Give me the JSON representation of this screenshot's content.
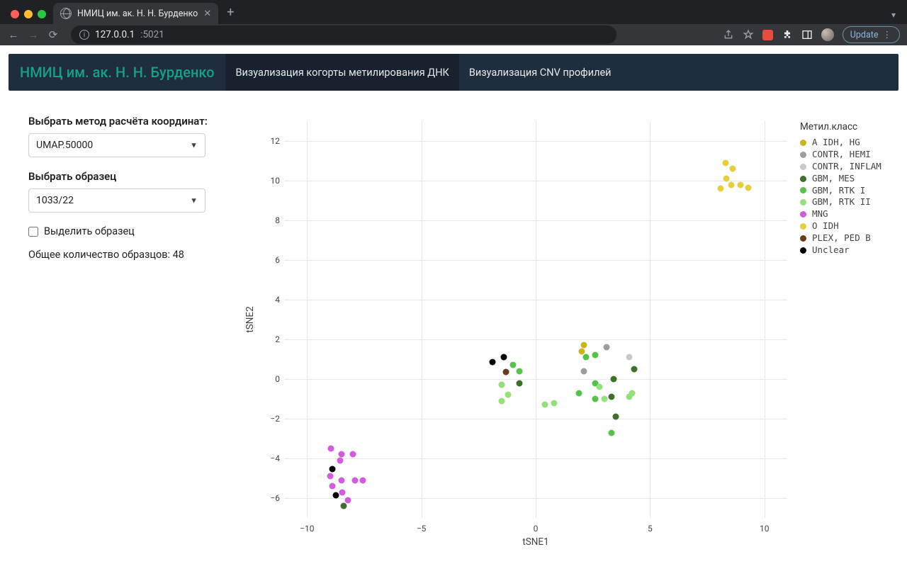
{
  "chrome": {
    "tab_title": "НМИЦ им. ак. Н. Н. Бурденко",
    "url_host": "127.0.0.1",
    "url_port": ":5021",
    "update_label": "Update"
  },
  "nav": {
    "brand": "НМИЦ им. ак. Н. Н. Бурденко",
    "item1": "Визуализация когорты метилирования ДНК",
    "item2": "Визуализация CNV профилей"
  },
  "sidebar": {
    "method_label": "Выбрать метод расчёта координат:",
    "method_value": "UMAP.50000",
    "sample_label": "Выбрать образец",
    "sample_value": "1033/22",
    "highlight_label": "Выделить образец",
    "count_text": "Общее количество образцов: 48"
  },
  "legend": {
    "title": "Метил.класс",
    "items": [
      {
        "label": "A IDH, HG",
        "color": "#c9b61f"
      },
      {
        "label": "CONTR, HEMI",
        "color": "#9d9d9d"
      },
      {
        "label": "CONTR, INFLAM",
        "color": "#c9c9c9"
      },
      {
        "label": "GBM, MES",
        "color": "#3f6f2a"
      },
      {
        "label": "GBM, RTK I",
        "color": "#55c24a"
      },
      {
        "label": "GBM, RTK II",
        "color": "#94e07a"
      },
      {
        "label": "MNG",
        "color": "#d25adf"
      },
      {
        "label": "O IDH",
        "color": "#e7cf3b"
      },
      {
        "label": "PLEX, PED B",
        "color": "#6b3a1f"
      },
      {
        "label": "Unclear",
        "color": "#000000"
      }
    ]
  },
  "chart_data": {
    "type": "scatter",
    "xlabel": "tSNE1",
    "ylabel": "tSNE2",
    "xlim": [
      -11,
      11
    ],
    "ylim": [
      -7,
      13
    ],
    "xticks": [
      -10,
      -5,
      0,
      5,
      10
    ],
    "yticks": [
      -6,
      -4,
      -2,
      0,
      2,
      4,
      6,
      8,
      10,
      12
    ],
    "series": [
      {
        "name": "A IDH, HG",
        "color": "#c9b61f",
        "points": [
          [
            2.0,
            1.4
          ],
          [
            2.1,
            1.7
          ]
        ]
      },
      {
        "name": "CONTR, HEMI",
        "color": "#9d9d9d",
        "points": [
          [
            2.1,
            0.4
          ],
          [
            3.1,
            1.6
          ]
        ]
      },
      {
        "name": "CONTR, INFLAM",
        "color": "#c9c9c9",
        "points": [
          [
            4.1,
            1.1
          ]
        ]
      },
      {
        "name": "GBM, MES",
        "color": "#3f6f2a",
        "points": [
          [
            -0.7,
            -0.2
          ],
          [
            3.4,
            0.0
          ],
          [
            3.3,
            -0.9
          ],
          [
            4.3,
            0.5
          ],
          [
            3.5,
            -1.9
          ],
          [
            -8.4,
            -6.4
          ]
        ]
      },
      {
        "name": "GBM, RTK I",
        "color": "#55c24a",
        "points": [
          [
            -1.0,
            0.7
          ],
          [
            -0.7,
            0.4
          ],
          [
            2.2,
            1.1
          ],
          [
            2.6,
            1.2
          ],
          [
            1.9,
            -0.7
          ],
          [
            2.6,
            -0.2
          ],
          [
            2.6,
            -1.0
          ],
          [
            3.3,
            -2.7
          ]
        ]
      },
      {
        "name": "GBM, RTK II",
        "color": "#94e07a",
        "points": [
          [
            -1.5,
            -0.3
          ],
          [
            -1.2,
            -0.8
          ],
          [
            -1.5,
            -1.1
          ],
          [
            0.4,
            -1.3
          ],
          [
            0.8,
            -1.2
          ],
          [
            2.8,
            -0.4
          ],
          [
            3.0,
            -1.0
          ],
          [
            4.1,
            -0.9
          ],
          [
            4.2,
            -0.7
          ]
        ]
      },
      {
        "name": "MNG",
        "color": "#d25adf",
        "points": [
          [
            -8.95,
            -3.5
          ],
          [
            -8.5,
            -3.8
          ],
          [
            -8.55,
            -4.1
          ],
          [
            -8.0,
            -3.8
          ],
          [
            -9.0,
            -4.9
          ],
          [
            -8.9,
            -5.4
          ],
          [
            -8.5,
            -5.1
          ],
          [
            -7.9,
            -5.1
          ],
          [
            -7.55,
            -5.1
          ],
          [
            -8.45,
            -5.7
          ],
          [
            -8.2,
            -6.1
          ]
        ]
      },
      {
        "name": "O IDH",
        "color": "#e7cf3b",
        "points": [
          [
            8.3,
            10.9
          ],
          [
            8.6,
            10.6
          ],
          [
            8.35,
            10.1
          ],
          [
            8.1,
            9.6
          ],
          [
            8.55,
            9.8
          ],
          [
            8.95,
            9.8
          ],
          [
            9.3,
            9.65
          ]
        ]
      },
      {
        "name": "PLEX, PED B",
        "color": "#6b3a1f",
        "points": [
          [
            -1.3,
            0.35
          ]
        ]
      },
      {
        "name": "Unclear",
        "color": "#000000",
        "points": [
          [
            -1.9,
            0.85
          ],
          [
            -1.4,
            1.1
          ],
          [
            -8.9,
            -4.55
          ],
          [
            -8.75,
            -5.85
          ]
        ]
      }
    ]
  }
}
